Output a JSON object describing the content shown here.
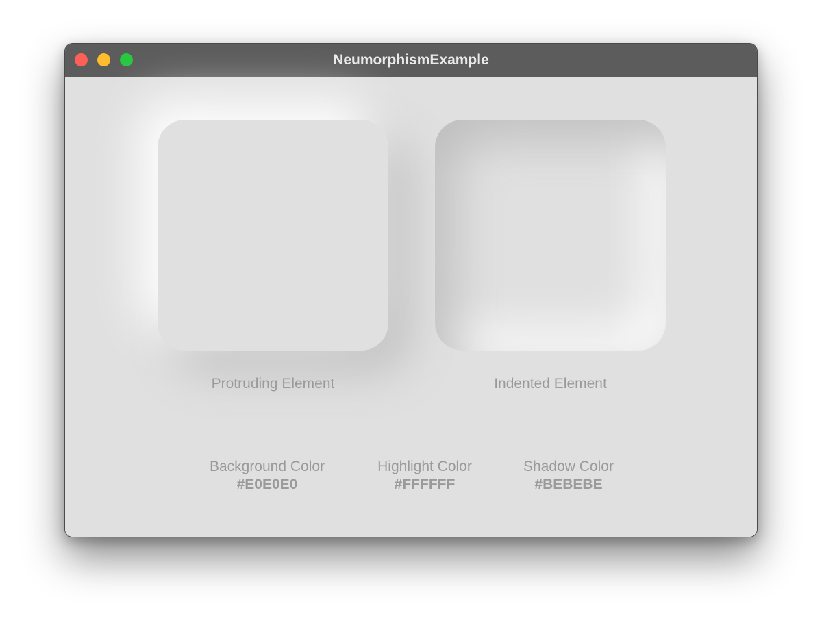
{
  "window": {
    "title": "NeumorphismExample"
  },
  "tiles": {
    "protruding_label": "Protruding Element",
    "indented_label": "Indented Element"
  },
  "colors": {
    "background": {
      "label": "Background Color",
      "value": "#E0E0E0"
    },
    "highlight": {
      "label": "Highlight Color",
      "value": "#FFFFFF"
    },
    "shadow": {
      "label": "Shadow Color",
      "value": "#BEBEBE"
    }
  },
  "traffic_lights": {
    "close": "#fe5f57",
    "minimize": "#febc2e",
    "zoom": "#28c840"
  }
}
